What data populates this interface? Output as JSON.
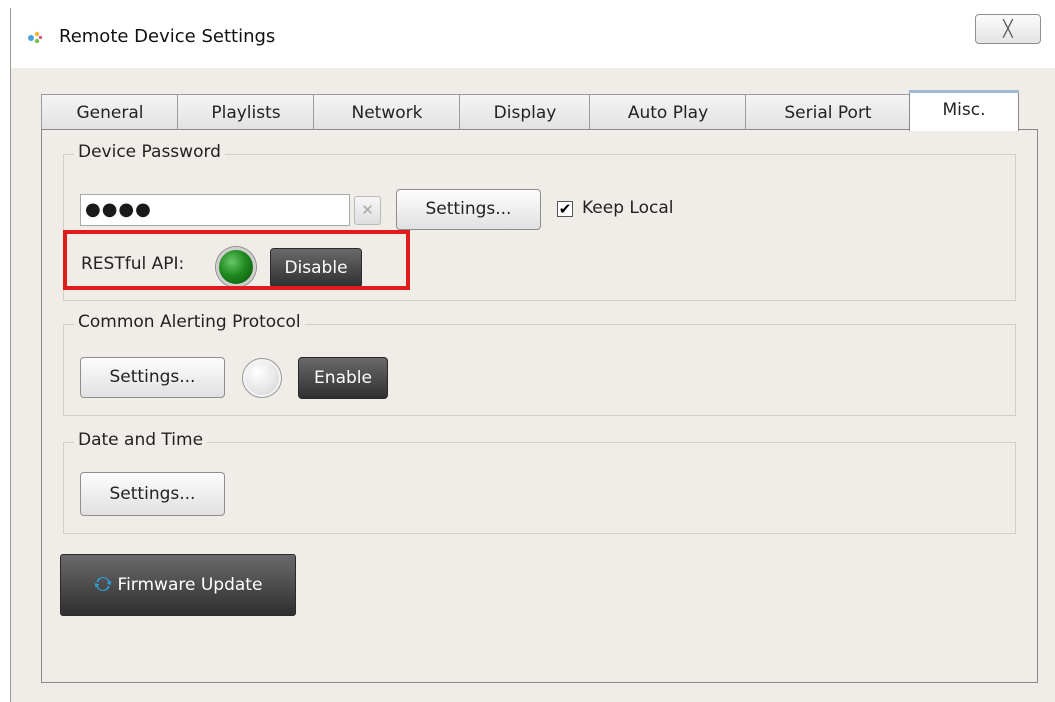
{
  "window": {
    "title": "Remote Device Settings",
    "close_label": "╳",
    "icon": "app-logo-icon"
  },
  "tabs": [
    {
      "label": "General"
    },
    {
      "label": "Playlists"
    },
    {
      "label": "Network"
    },
    {
      "label": "Display"
    },
    {
      "label": "Auto Play"
    },
    {
      "label": "Serial Port"
    },
    {
      "label": "Misc.",
      "active": true
    }
  ],
  "device_password": {
    "group_label": "Device Password",
    "password_value": "●●●●",
    "clear_label": "✕",
    "settings_label": "Settings...",
    "keep_local_label": "Keep Local",
    "keep_local_checked": true,
    "restful_label": "RESTful API:",
    "restful_status": "on",
    "restful_button_label": "Disable"
  },
  "cap": {
    "group_label": "Common Alerting Protocol",
    "settings_label": "Settings...",
    "status": "off",
    "button_label": "Enable"
  },
  "date_time": {
    "group_label": "Date and Time",
    "settings_label": "Settings..."
  },
  "firmware": {
    "button_label": "Firmware Update",
    "icon": "refresh-icon"
  },
  "colors": {
    "highlight": "#e01b1b",
    "led_on": "#1f8a1f",
    "dark_button": "#3a3a3a",
    "refresh_icon": "#2aa4e0"
  }
}
